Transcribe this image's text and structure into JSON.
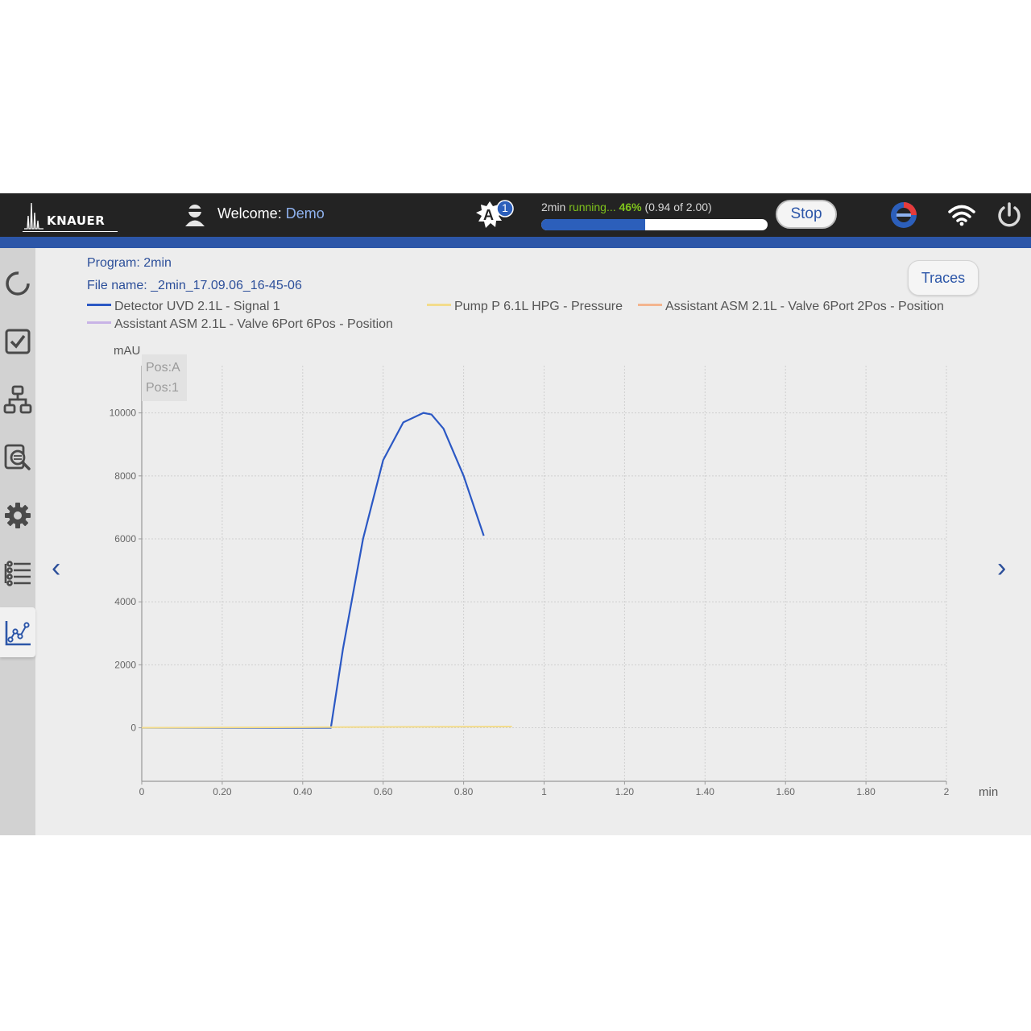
{
  "header": {
    "brand": "KNAUER",
    "welcome_label": "Welcome:",
    "user_name": "Demo",
    "alert_letter": "A",
    "alert_count": "1",
    "run": {
      "program": "2min",
      "state": "running...",
      "percent": "46%",
      "detail": "(0.94 of 2.00)",
      "progress_fraction": 0.46
    },
    "stop_label": "Stop"
  },
  "sidebar": {
    "items": [
      {
        "name": "status-icon",
        "active": false
      },
      {
        "name": "checklist-icon",
        "active": false
      },
      {
        "name": "flow-diagram-icon",
        "active": false
      },
      {
        "name": "data-search-icon",
        "active": false
      },
      {
        "name": "gear-icon",
        "active": false
      },
      {
        "name": "list-icon",
        "active": false
      },
      {
        "name": "chart-icon",
        "active": true
      }
    ]
  },
  "main": {
    "program_line": "Program: 2min",
    "file_line": "File name: _2min_17.09.06_16-45-06",
    "traces_label": "Traces",
    "prev_label": "‹",
    "next_label": "›"
  },
  "colors": {
    "signal": "#2b58c4",
    "pressure": "#f3dc8c",
    "valve2": "#f4b58f",
    "valve6": "#c8b3e6",
    "accent": "#2c56a8"
  },
  "chart_data": {
    "type": "line",
    "ylabel": "mAU",
    "xlabel": "min",
    "xlim": [
      0,
      2
    ],
    "ylim": [
      -1700,
      11500
    ],
    "x_ticks": [
      "0",
      "0.20",
      "0.40",
      "0.60",
      "0.80",
      "1",
      "1.20",
      "1.40",
      "1.60",
      "1.80",
      "2"
    ],
    "y_ticks": [
      "0",
      "2000",
      "4000",
      "6000",
      "8000",
      "10000"
    ],
    "position_labels": [
      "Pos:A",
      "Pos:1"
    ],
    "grid": true,
    "legend_position": "top",
    "series": [
      {
        "name": "Detector UVD 2.1L - Signal 1",
        "color": "#2b58c4",
        "x": [
          0,
          0.1,
          0.2,
          0.3,
          0.4,
          0.47,
          0.5,
          0.55,
          0.6,
          0.65,
          0.7,
          0.72,
          0.75,
          0.8,
          0.85
        ],
        "y": [
          0,
          0,
          0,
          0,
          0,
          0,
          2500,
          6000,
          8500,
          9700,
          10000,
          9950,
          9500,
          8000,
          6100
        ]
      },
      {
        "name": "Pump P 6.1L HPG - Pressure",
        "color": "#f3dc8c",
        "x": [
          0,
          0.47,
          0.92
        ],
        "y": [
          0,
          20,
          40
        ]
      },
      {
        "name": "Assistant ASM 2.1L - Valve 6Port 2Pos - Position",
        "color": "#f4b58f",
        "x": [],
        "y": []
      },
      {
        "name": "Assistant ASM 2.1L - Valve 6Port 6Pos - Position",
        "color": "#c8b3e6",
        "x": [],
        "y": []
      }
    ]
  }
}
